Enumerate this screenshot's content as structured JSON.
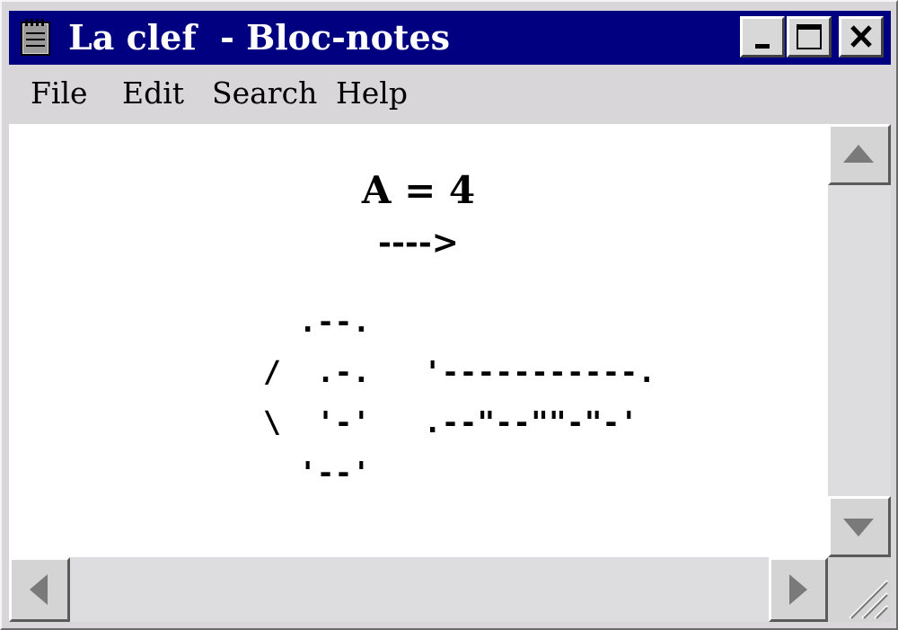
{
  "window": {
    "title": "La clef  - Bloc-notes",
    "controls": {
      "minimize": "minimize-icon",
      "maximize": "maximize-icon",
      "close": "close-icon"
    }
  },
  "menu": {
    "file": "File",
    "edit": "Edit",
    "search": "Search",
    "help": "Help"
  },
  "document": {
    "line1": "A = 4",
    "line2": "---->",
    "art": [
      "  .--.",
      "/  .-.   '-----------.",
      "\\  '-'   .--\"--\"\"-\"-'",
      "  '--'"
    ]
  },
  "scrollbars": {
    "vertical": {
      "up": "arrow-up-icon",
      "down": "arrow-down-icon"
    },
    "horizontal": {
      "left": "arrow-left-icon",
      "right": "arrow-right-icon"
    },
    "resize_grip": "resize-grip-icon"
  },
  "colors": {
    "titlebar": "#000080",
    "chrome": "#d8d6d8",
    "editor_background": "#ffffff",
    "scroll_track": "#dddcdf"
  }
}
